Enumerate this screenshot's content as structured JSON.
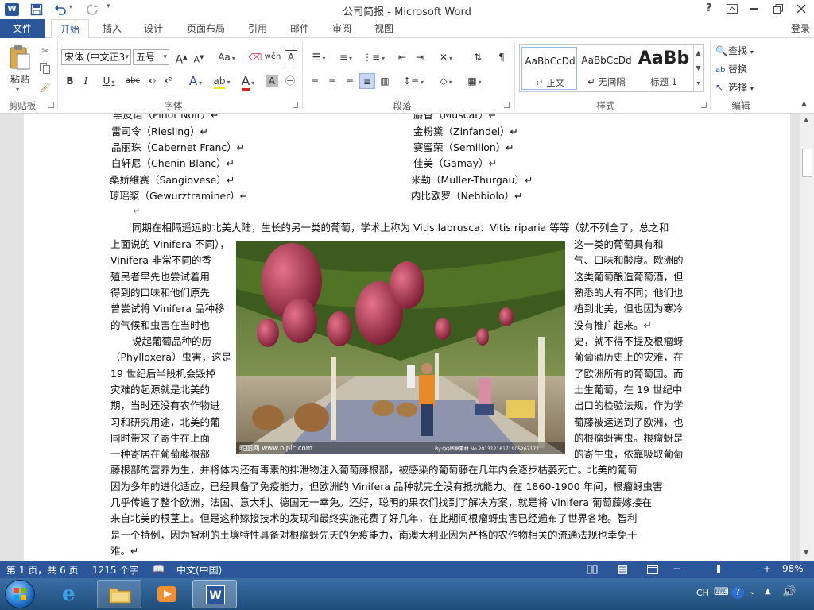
{
  "window": {
    "title": "公司简报 - Microsoft Word",
    "help_glyph": "?",
    "signin": "登录"
  },
  "tabs": {
    "file": "文件",
    "items": [
      "开始",
      "插入",
      "设计",
      "页面布局",
      "引用",
      "邮件",
      "审阅",
      "视图"
    ],
    "active": "开始"
  },
  "ribbon": {
    "clipboard": {
      "paste": "粘贴",
      "label": "剪贴板"
    },
    "font": {
      "name": "宋体 (中文正3",
      "size": "五号",
      "label": "字体",
      "bold": "B",
      "italic": "I",
      "underline": "U",
      "strike": "abc",
      "sub": "x₂",
      "sup": "x²",
      "clear": "Aa",
      "phonetic": "wén",
      "border_a": "A"
    },
    "paragraph": {
      "label": "段落"
    },
    "styles": {
      "label": "样式",
      "items": [
        {
          "sample": "AaBbCcDd",
          "name": "↵ 正文",
          "selected": true
        },
        {
          "sample": "AaBbCcDd",
          "name": "↵ 无间隔",
          "selected": false
        },
        {
          "sample": "AaBb",
          "name": "标题 1",
          "selected": false
        }
      ]
    },
    "editing": {
      "find": "查找",
      "replace": "替换",
      "select": "选择",
      "label": "编辑"
    }
  },
  "document": {
    "grape_list": [
      {
        "left": "黑皮诺（Pinot Noir）↵",
        "right": "麝香（Muscat）↵"
      },
      {
        "left": "雷司令（Riesling）↵",
        "right": "金粉黛（Zinfandel）↵"
      },
      {
        "left": "品丽珠（Cabernet Franc）↵",
        "right": "赛蜜荣（Semillon）↵"
      },
      {
        "left": "白轩尼（Chenin Blanc）↵",
        "right": "佳美（Gamay）↵"
      },
      {
        "left": "桑娇维赛（Sangiovese）↵",
        "right": "米勒（Muller-Thurgau）↵"
      },
      {
        "left": "琼瑶浆（Gewurztraminer）↵",
        "right": "内比欧罗（Nebbiolo）↵"
      }
    ],
    "empty_mark": "↵",
    "para1_first": "同期在相隔遥远的北美大陆，生长的另一类的葡萄，学术上称为 Vitis labrusca、Vitis riparia 等等（就不列全了，总之和",
    "left_col": [
      "上面说的 Vinifera 不同），",
      "Vinifera  非常不同的香",
      "殖民者早先也尝试着用",
      "得到的口味和他们原先",
      "曾尝试将 Vinifera 品种移",
      "的气候和虫害在当时也",
      "说起葡萄品种的历",
      "（Phylloxera）虫害，这是",
      "19 世纪后半段机会毁掉",
      "灾难的起源就是北美的",
      "期，当时还没有农作物进",
      "习和研究用途，北美的葡",
      "同时带来了寄生在上面",
      "一种寄居在葡萄藤根部"
    ],
    "right_col": [
      "这一类的葡萄具有和",
      "气、口味和酸度。欧洲的",
      "这类葡萄酿造葡萄酒，但",
      "熟悉的大有不同；他们也",
      "植到北美，但也因为寒冷",
      "没有推广起来。↵",
      "史，就不得不提及根瘤蚜",
      "葡萄酒历史上的灾难，在",
      "了欧洲所有的葡萄园。而",
      "土生葡萄，在 19 世纪中",
      "出口的检验法规，作为学",
      "萄藤被运送到了欧洲，也",
      "的根瘤蚜害虫。根瘤蚜是",
      "的寄生虫，依靠吸取葡萄"
    ],
    "bottom_lines": [
      "藤根部的营养为生，并将体内还有毒素的排泄物注入葡萄藤根部，被感染的葡萄藤在几年内会逐步枯萎死亡。北美的葡萄",
      "因为多年的进化适应，已经具备了免疫能力，但欧洲的 Vinifera 品种就完全没有抵抗能力。在 1860-1900 年间，根瘤蚜虫害",
      "几乎传遍了整个欧洲，法国、意大利、德国无一幸免。还好，聪明的果农们找到了解决方案，就是将 Vinifera 葡萄藤嫁接在",
      "来自北美的根茎上。但是这种嫁接技术的发现和最终实施花费了好几年，在此期间根瘤蚜虫害已经遍布了世界各地。智利",
      "是一个特例，因为智利的土壤特性具备对根瘤蚜先天的免疫能力，南澳大利亚因为严格的农作物相关的流通法规也幸免于",
      "难。↵"
    ],
    "image_watermark_left": "昵图网 www.nipic.com",
    "image_watermark_right": "By:QQ图稿素材  No.20131216171905267172"
  },
  "statusbar": {
    "page": "第 1 页，共 6 页",
    "words": "1215 个字",
    "lang": "中文(中国)",
    "zoom": "98%"
  },
  "taskbar": {
    "ime": "CH"
  },
  "colors": {
    "accent": "#2b579a",
    "status_bg": "#2b579a"
  }
}
